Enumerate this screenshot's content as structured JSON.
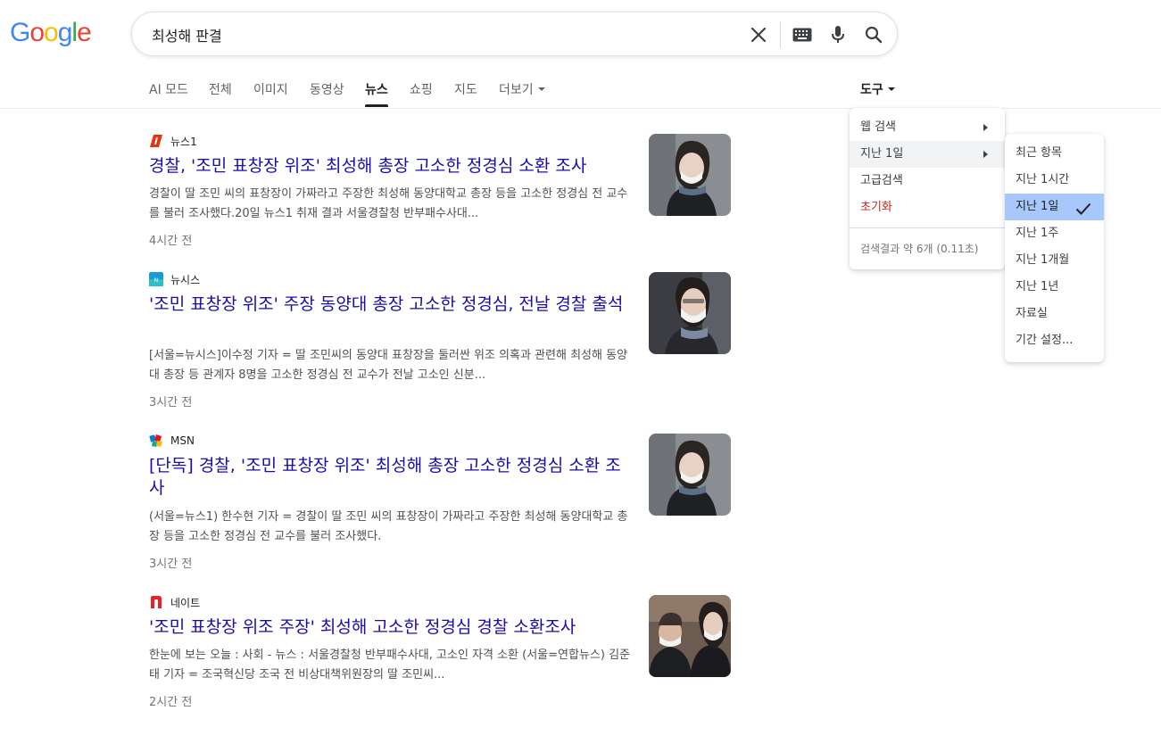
{
  "logo": {
    "letters": [
      "G",
      "o",
      "o",
      "g",
      "l",
      "e"
    ],
    "colors": [
      "#4285F4",
      "#EA4335",
      "#FBBC05",
      "#4285F4",
      "#34A853",
      "#EA4335"
    ]
  },
  "search": {
    "query": "최성해 판결",
    "clear_icon": "close-icon",
    "keyboard_icon": "keyboard-icon",
    "mic_icon": "mic-icon",
    "search_icon": "search-icon"
  },
  "tabs": {
    "items": [
      "AI 모드",
      "전체",
      "이미지",
      "동영상",
      "뉴스",
      "쇼핑",
      "지도",
      "더보기"
    ],
    "active": "뉴스",
    "tools": "도구"
  },
  "tools_menu": {
    "items": [
      "웹 검색",
      "지난 1일",
      "고급검색",
      "초기화"
    ],
    "reset_color": "#c5221f",
    "stats": "검색결과 약 6개 (0.11초)"
  },
  "time_menu": {
    "items": [
      "최근 항목",
      "지난 1시간",
      "지난 1일",
      "지난 1주",
      "지난 1개월",
      "지난 1년",
      "자료실",
      "기간 설정..."
    ],
    "selected": "지난 1일",
    "check_icon": "checkmark-icon"
  },
  "results": [
    {
      "source": "뉴스1",
      "title": "경찰, '조민 표창장 위조' 최성해 총장 고소한 정경심 소환 조사",
      "snippet": "경찰이 딸 조민 씨의 표창장이 가짜라고 주장한 최성해 동양대학교 총장 등을 고소한 정경심 전 교수를 불러 조사했다.20일 뉴스1 취재 결과 서울경찰청 반부패수사대...",
      "time": "4시간 전",
      "favicon_color": "#e8330e"
    },
    {
      "source": "뉴시스",
      "title": "'조민 표창장 위조' 주장 동양대 총장 고소한 정경심, 전날 경찰 출석",
      "snippet": "[서울=뉴시스]이수정 기자 = 딸 조민씨의 동양대 표창장을 둘러싼 위조 의혹과 관련해 최성해 동양대 총장 등 관계자 8명을 고소한 정경심 전 교수가 전날 고소인 신분...",
      "time": "3시간 전",
      "favicon_color": "#1a9bd7"
    },
    {
      "source": "MSN",
      "title": "[단독] 경찰, '조민 표창장 위조' 최성해 총장 고소한 정경심 소환 조사",
      "snippet": "(서울=뉴스1) 한수현 기자 = 경찰이 딸 조민 씨의 표창장이 가짜라고 주장한 최성해 동양대학교 총장 등을 고소한 정경심 전 교수를 불러 조사했다.",
      "time": "3시간 전",
      "favicon_color": "#0078d4"
    },
    {
      "source": "네이트",
      "title": "'조민 표창장 위조 주장' 최성해 고소한 정경심 경찰 소환조사",
      "snippet": "한눈에 보는 오늘 : 사회 - 뉴스 : 서울경찰청 반부패수사대, 고소인 자격 소환 (서울=연합뉴스) 김준태 기자 = 조국혁신당 조국 전 비상대책위원장의 딸 조민씨...",
      "time": "2시간 전",
      "favicon_color": "#e8212c"
    }
  ]
}
